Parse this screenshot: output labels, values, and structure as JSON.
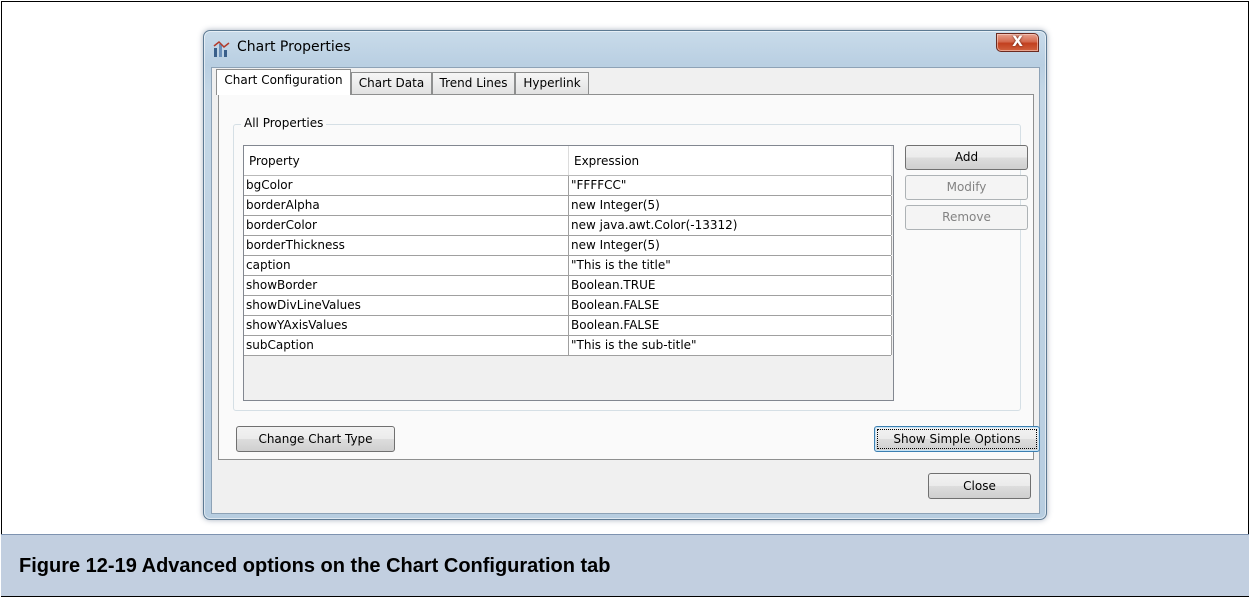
{
  "window": {
    "title": "Chart Properties",
    "close_glyph": "X",
    "accent": "#c2401f"
  },
  "tabs": [
    {
      "label": "Chart Configuration",
      "active": true
    },
    {
      "label": "Chart Data",
      "active": false
    },
    {
      "label": "Trend Lines",
      "active": false
    },
    {
      "label": "Hyperlink",
      "active": false
    }
  ],
  "group": {
    "label": "All Properties"
  },
  "table": {
    "columns": [
      "Property",
      "Expression"
    ],
    "rows": [
      {
        "property": "bgColor",
        "expression": "\"FFFFCC\""
      },
      {
        "property": "borderAlpha",
        "expression": "new Integer(5)"
      },
      {
        "property": "borderColor",
        "expression": "new java.awt.Color(-13312)"
      },
      {
        "property": "borderThickness",
        "expression": "new Integer(5)"
      },
      {
        "property": "caption",
        "expression": "\"This is the title\""
      },
      {
        "property": "showBorder",
        "expression": "Boolean.TRUE"
      },
      {
        "property": "showDivLineValues",
        "expression": "Boolean.FALSE"
      },
      {
        "property": "showYAxisValues",
        "expression": "Boolean.FALSE"
      },
      {
        "property": "subCaption",
        "expression": "\"This is the sub-title\""
      }
    ]
  },
  "buttons": {
    "add": "Add",
    "modify": "Modify",
    "remove": "Remove",
    "change_chart_type": "Change Chart Type",
    "show_simple_options": "Show Simple Options",
    "close": "Close"
  },
  "figure_caption": "Figure 12-19  Advanced options on the Chart Configuration tab"
}
